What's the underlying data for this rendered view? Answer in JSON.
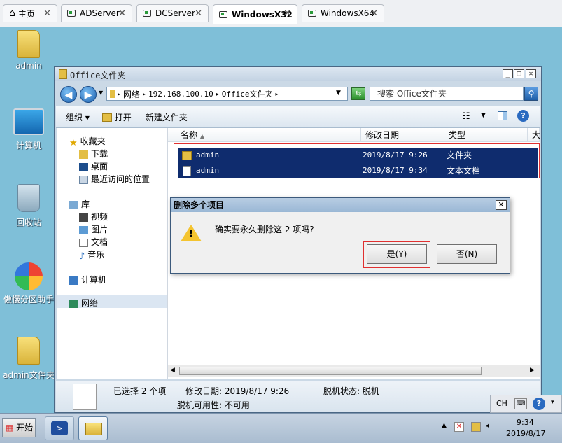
{
  "tabs": [
    {
      "label": "主页",
      "icon": "home-icon"
    },
    {
      "label": "ADServer",
      "icon": "vm-icon"
    },
    {
      "label": "DCServer",
      "icon": "vm-icon"
    },
    {
      "label": "WindowsX32",
      "icon": "vm-icon",
      "active": true
    },
    {
      "label": "WindowsX64",
      "icon": "vm-icon"
    }
  ],
  "desktop": {
    "icons": [
      {
        "label": "admin",
        "icon": "user-folder-icon"
      },
      {
        "label": "计算机",
        "icon": "computer-icon"
      },
      {
        "label": "回收站",
        "icon": "recycle-bin-icon"
      },
      {
        "label": "傲慢分区助手",
        "icon": "partition-assistant-icon"
      },
      {
        "label": "admin文件夹",
        "icon": "folder-icon"
      }
    ]
  },
  "explorer": {
    "title": "Office文件夹",
    "address": [
      "网络",
      "192.168.100.10",
      "Office文件夹"
    ],
    "search_placeholder": "搜索 Office文件夹",
    "toolbar": {
      "organize": "组织",
      "open": "打开",
      "new_folder": "新建文件夹"
    },
    "nav": {
      "favorites": "收藏夹",
      "favorites_items": [
        "下载",
        "桌面",
        "最近访问的位置"
      ],
      "libraries": "库",
      "libraries_items": [
        "视频",
        "图片",
        "文档",
        "音乐"
      ],
      "computer": "计算机",
      "network": "网络"
    },
    "columns": [
      "名称",
      "修改日期",
      "类型",
      "大"
    ],
    "files": [
      {
        "name": "admin",
        "date": "2019/8/17 9:26",
        "type": "文件夹",
        "icon": "folder-icon"
      },
      {
        "name": "admin",
        "date": "2019/8/17 9:34",
        "type": "文本文档",
        "icon": "text-file-icon"
      }
    ],
    "status": {
      "selected": "已选择 2 个项",
      "modified": "修改日期: 2019/8/17 9:26",
      "offline_status": "脱机状态: 脱机",
      "offline_avail": "脱机可用性: 不可用"
    }
  },
  "dialog": {
    "title": "删除多个项目",
    "message": "确实要永久删除这 2 项吗?",
    "yes": "是(Y)",
    "no": "否(N)"
  },
  "taskbar": {
    "start": "开始",
    "lang": "CH",
    "time": "9:34",
    "date": "2019/8/17"
  },
  "colors": {
    "selection": "#0f2c6e",
    "highlight_box": "#e03030",
    "desktop": "#7fbfd8"
  }
}
